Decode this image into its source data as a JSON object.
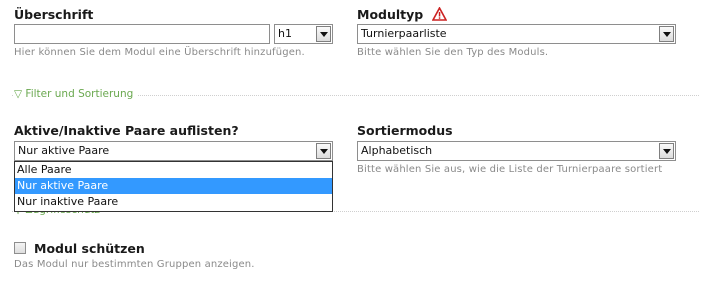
{
  "headline": {
    "label": "Überschrift",
    "value": "",
    "level": "h1",
    "hint": "Hier können Sie dem Modul eine Überschrift hinzufügen."
  },
  "module_type": {
    "label": "Modultyp",
    "value": "Turnierpaarliste",
    "hint": "Bitte wählen Sie den Typ des Moduls."
  },
  "filter_section": {
    "legend": "Filter und Sortierung"
  },
  "list_pairs": {
    "label": "Aktive/Inaktive Paare auflisten?",
    "value": "Nur aktive Paare",
    "options": [
      "Alle Paare",
      "Nur aktive Paare",
      "Nur inaktive Paare"
    ],
    "highlighted_index": 1
  },
  "sort_mode": {
    "label": "Sortiermodus",
    "value": "Alphabetisch",
    "hint": "Bitte wählen Sie aus, wie die Liste der Turnierpaare sortiert"
  },
  "access_section": {
    "legend": "Zugriffsschutz"
  },
  "protect": {
    "label": "Modul schützen",
    "checked": false,
    "hint": "Das Modul nur bestimmten Gruppen anzeigen."
  },
  "colors": {
    "accent_green": "#6aa84f",
    "highlight_blue": "#3399ff",
    "warning_red": "#cc2222"
  }
}
